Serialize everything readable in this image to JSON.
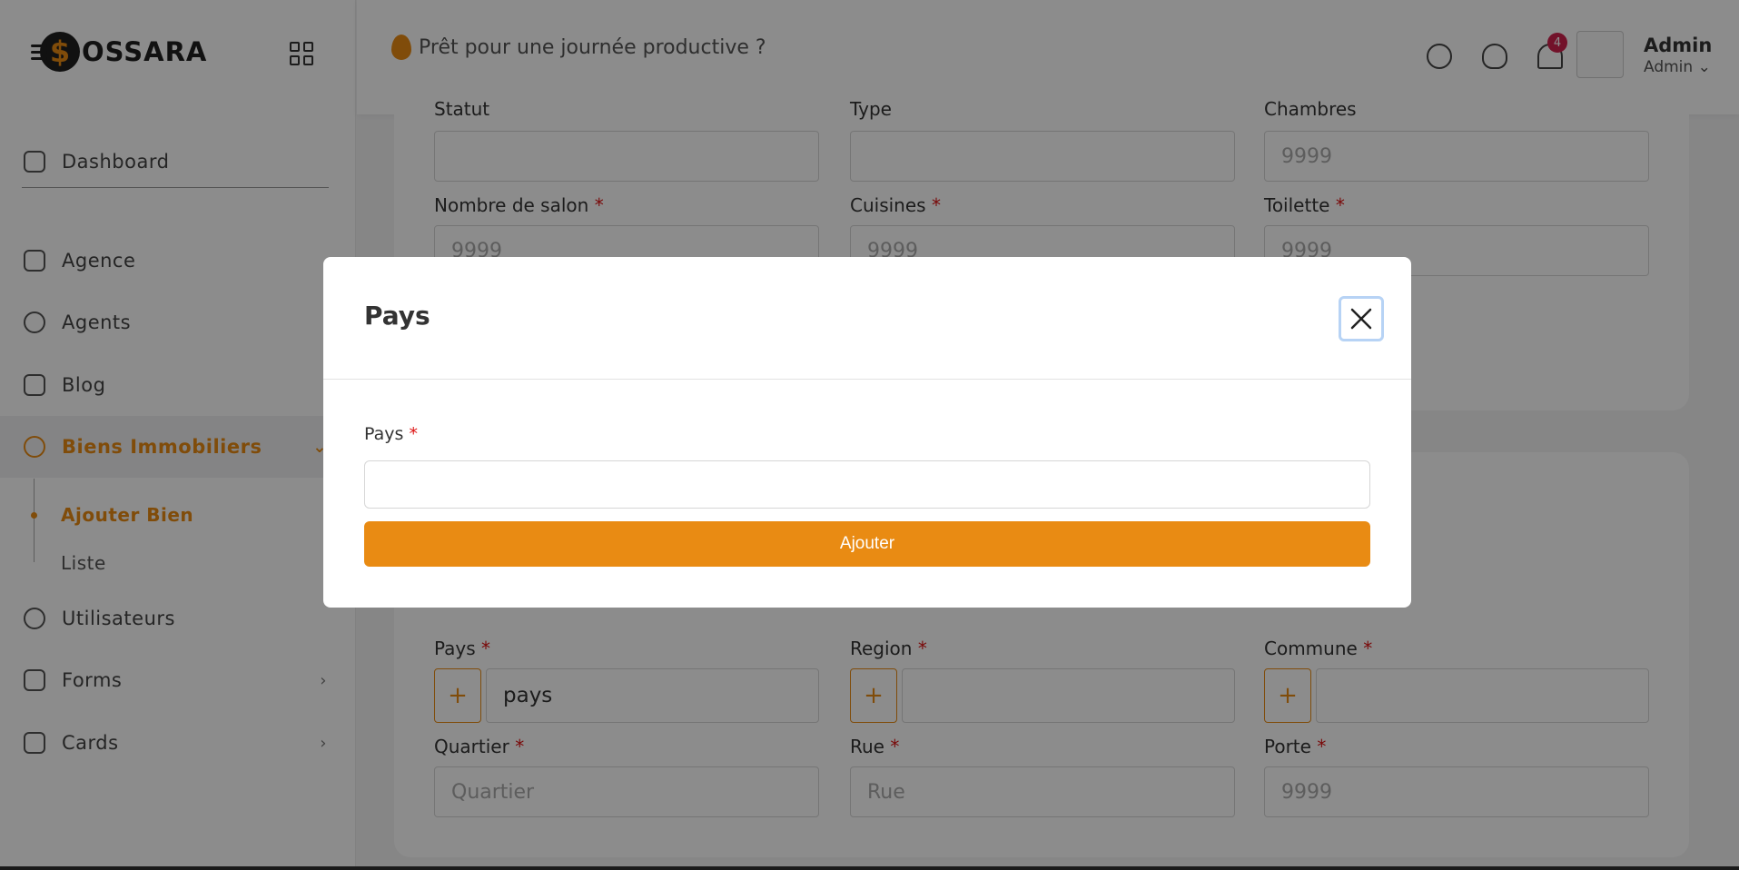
{
  "brand": {
    "name": "OSSARA",
    "mark": "$"
  },
  "topbar": {
    "greeting": "Prêt pour une journée productive ?",
    "notification_count": "4",
    "user_name": "Admin",
    "user_role": "Admin ⌄"
  },
  "sidebar": {
    "dashboard": "Dashboard",
    "items": [
      {
        "label": "Agence"
      },
      {
        "label": "Agents"
      },
      {
        "label": "Blog"
      },
      {
        "label": "Biens Immobiliers"
      },
      {
        "label": "Utilisateurs"
      },
      {
        "label": "Forms"
      },
      {
        "label": "Cards"
      }
    ],
    "subitems": [
      {
        "label": "Ajouter Bien"
      },
      {
        "label": "Liste"
      }
    ]
  },
  "form_top": {
    "labels": [
      "Statut",
      "Type",
      "Chambres"
    ],
    "chambres_placeholder": "9999",
    "row2_labels": [
      "Nombre de salon",
      "Cuisines",
      "Toilette"
    ],
    "placeholder": "9999",
    "required_mark": "*"
  },
  "form_address": {
    "pays_label": "Pays",
    "region_label": "Region",
    "commune_label": "Commune",
    "pays_value": "pays",
    "plus": "+",
    "quartier_label": "Quartier",
    "rue_label": "Rue",
    "porte_label": "Porte",
    "quartier_placeholder": "Quartier",
    "rue_placeholder": "Rue",
    "porte_placeholder": "9999"
  },
  "modal": {
    "title": "Pays",
    "field_label": "Pays",
    "required_mark": "*",
    "field_value": "",
    "submit_label": "Ajouter"
  },
  "colors": {
    "accent": "#e98b13",
    "badge": "#d0214d"
  }
}
